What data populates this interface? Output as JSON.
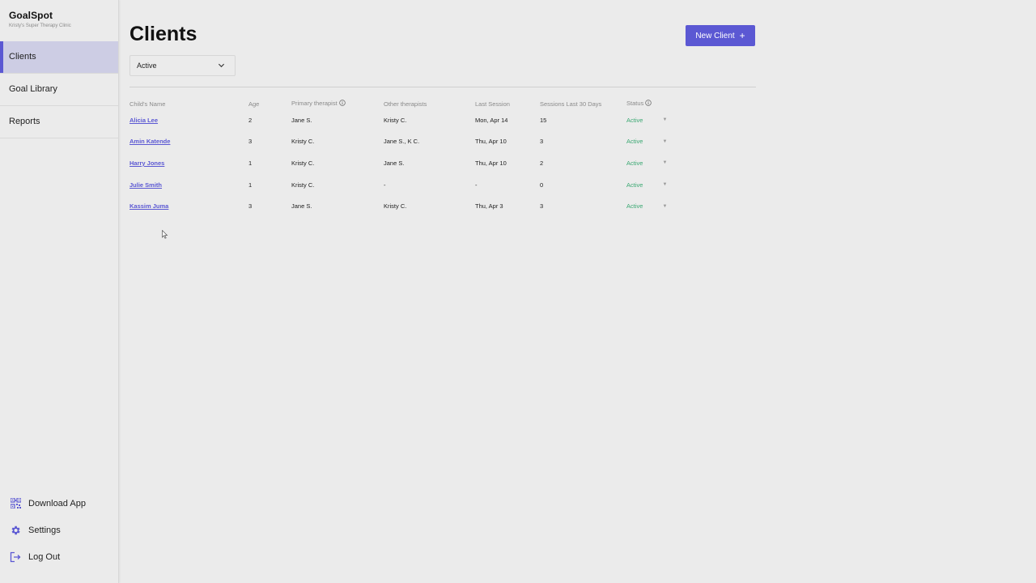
{
  "sidebar": {
    "brand_name": "GoalSpot",
    "brand_sub": "Kristy's Super Therapy Clinic",
    "items": [
      {
        "label": "Clients",
        "active": true
      },
      {
        "label": "Goal Library",
        "active": false
      },
      {
        "label": "Reports",
        "active": false
      }
    ],
    "bottom": [
      {
        "label": "Download App",
        "icon": "qr-code-icon"
      },
      {
        "label": "Settings",
        "icon": "gear-icon"
      },
      {
        "label": "Log Out",
        "icon": "logout-icon"
      }
    ]
  },
  "main": {
    "title": "Clients",
    "new_client_label": "New Client",
    "filter_value": "Active",
    "table": {
      "headers": [
        "Child's Name",
        "Age",
        "Primary therapist",
        "Other therapists",
        "Last Session",
        "Sessions Last 30 Days",
        "Status"
      ],
      "rows": [
        {
          "name": "Alicia Lee",
          "age": "2",
          "primary": "Jane S.",
          "other": "Kristy C.",
          "last": "Mon, Apr 14",
          "sessions": "15",
          "status": "Active"
        },
        {
          "name": "Amin Katende",
          "age": "3",
          "primary": "Kristy C.",
          "other": "Jane S., K C.",
          "last": "Thu, Apr 10",
          "sessions": "3",
          "status": "Active"
        },
        {
          "name": "Harry Jones",
          "age": "1",
          "primary": "Kristy C.",
          "other": "Jane S.",
          "last": "Thu, Apr 10",
          "sessions": "2",
          "status": "Active"
        },
        {
          "name": "Julie Smith",
          "age": "1",
          "primary": "Kristy C.",
          "other": "-",
          "last": "-",
          "sessions": "0",
          "status": "Active"
        },
        {
          "name": "Kassim Juma",
          "age": "3",
          "primary": "Jane S.",
          "other": "Kristy C.",
          "last": "Thu, Apr 3",
          "sessions": "3",
          "status": "Active"
        }
      ]
    }
  },
  "colors": {
    "accent": "#5b58d3",
    "status_active": "#3aa872",
    "background": "#ebebeb",
    "nav_active_bg": "#cdcde4"
  }
}
